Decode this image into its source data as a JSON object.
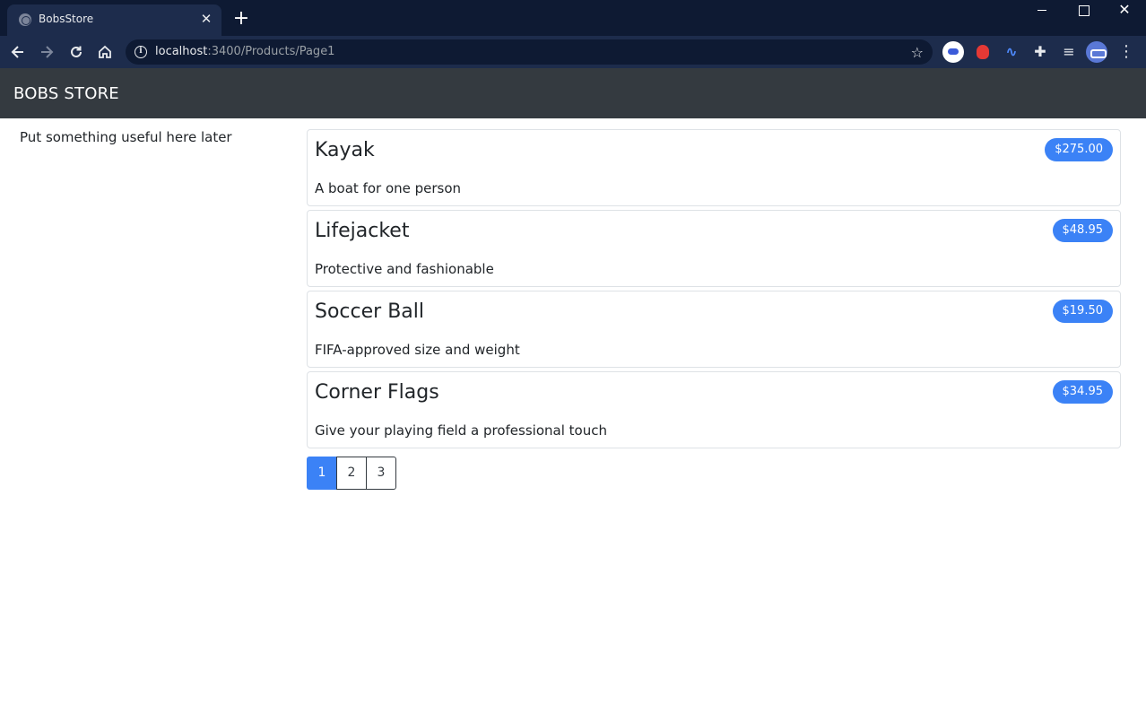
{
  "browser": {
    "tab_title": "BobsStore",
    "url_host": "localhost",
    "url_path": ":3400/Products/Page1",
    "icons": {
      "tab_favicon": "globe-icon",
      "close": "close-icon",
      "new_tab": "plus-icon",
      "back": "arrow-left-icon",
      "forward": "arrow-right-icon",
      "reload": "reload-icon",
      "home": "home-icon",
      "info": "info-icon",
      "bookmark": "star-icon",
      "extensions": "puzzle-icon",
      "media": "playlist-icon",
      "menu": "kebab-menu-icon"
    },
    "colors": {
      "titlebar": "#0e1a33",
      "toolbar": "#1d2c4c"
    }
  },
  "header": {
    "brand": "BOBS STORE",
    "background": "#343a40"
  },
  "sidebar": {
    "text": "Put something useful here later"
  },
  "products": [
    {
      "name": "Kayak",
      "description": "A boat for one person",
      "price": "$275.00"
    },
    {
      "name": "Lifejacket",
      "description": "Protective and fashionable",
      "price": "$48.95"
    },
    {
      "name": "Soccer Ball",
      "description": "FIFA-approved size and weight",
      "price": "$19.50"
    },
    {
      "name": "Corner Flags",
      "description": "Give your playing field a professional touch",
      "price": "$34.95"
    }
  ],
  "pagination": {
    "pages": [
      "1",
      "2",
      "3"
    ],
    "active": "1",
    "active_color": "#3b82f6"
  }
}
